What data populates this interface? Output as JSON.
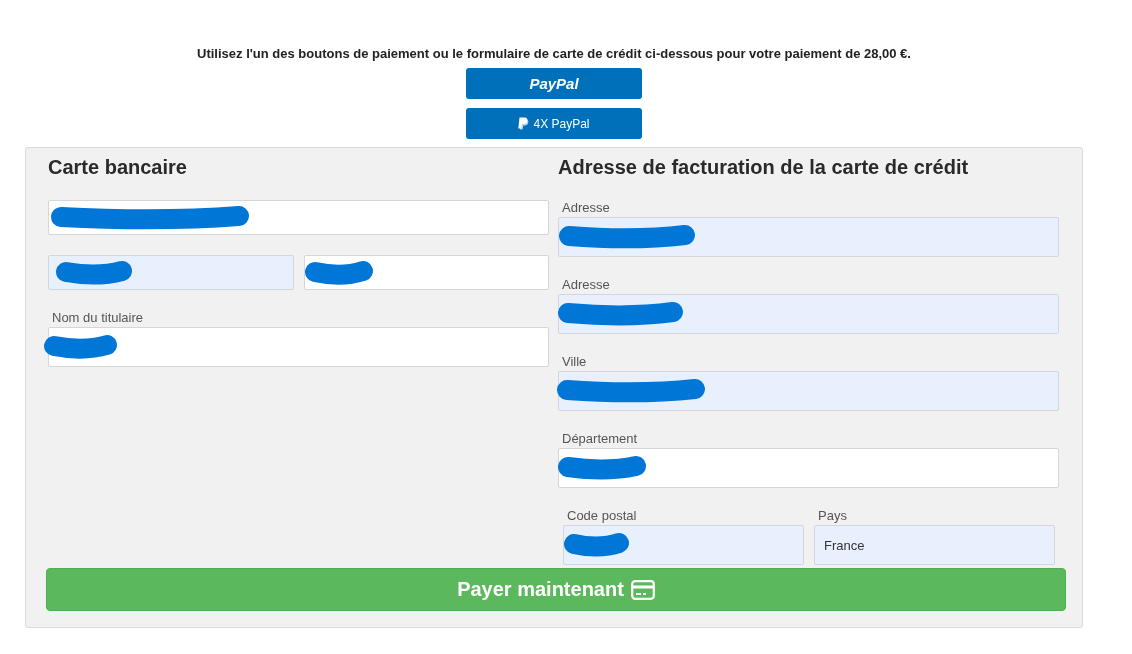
{
  "intro": "Utilisez l'un des boutons de paiement ou le formulaire de carte de crédit ci-dessous pour votre paiement de 28,00 €.",
  "payment_buttons": [
    {
      "kind": "paypal",
      "label": "PayPal"
    },
    {
      "kind": "installments",
      "label": "4X PayPal"
    }
  ],
  "card_section": {
    "title": "Carte bancaire",
    "rows": [
      {
        "fields": [
          {
            "redacted": true,
            "autofilled": false
          }
        ]
      },
      {
        "fields": [
          {
            "redacted": true,
            "autofilled": true
          },
          {
            "redacted": true,
            "autofilled": false
          }
        ]
      },
      {
        "fields": [
          {
            "label": "Nom du titulaire",
            "redacted": true,
            "autofilled": false
          }
        ]
      }
    ]
  },
  "billing_section": {
    "title": "Adresse de facturation de la carte de crédit",
    "rows": [
      {
        "fields": [
          {
            "label": "Adresse",
            "redacted": true,
            "autofilled": true
          }
        ]
      },
      {
        "fields": [
          {
            "label": "Adresse",
            "redacted": true,
            "autofilled": true
          }
        ]
      },
      {
        "fields": [
          {
            "label": "Ville",
            "redacted": true,
            "autofilled": true
          }
        ]
      },
      {
        "fields": [
          {
            "label": "Département",
            "redacted": true,
            "autofilled": false
          }
        ]
      },
      {
        "fields": [
          {
            "label": "Code postal",
            "redacted": true,
            "autofilled": true
          },
          {
            "label": "Pays",
            "value": "France",
            "redacted": false,
            "autofilled": true
          }
        ]
      }
    ]
  },
  "pay_button": {
    "label": "Payer maintenant"
  }
}
